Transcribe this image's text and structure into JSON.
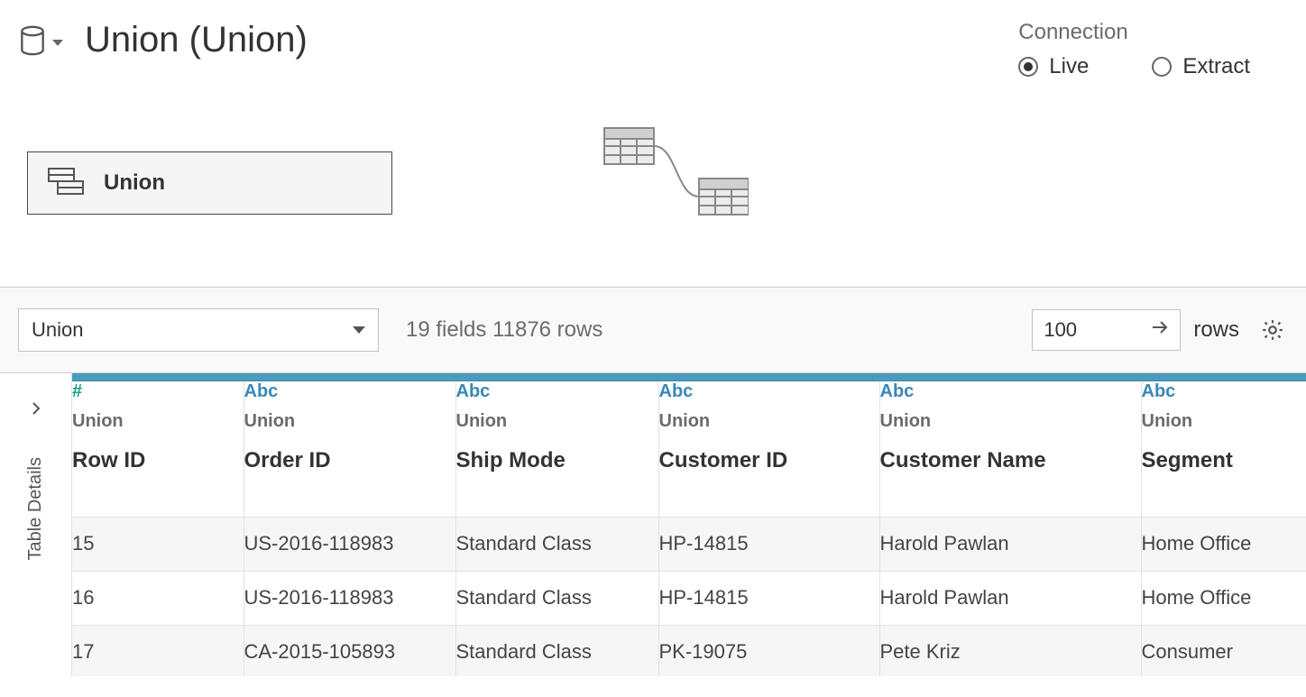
{
  "header": {
    "title": "Union (Union)"
  },
  "connection": {
    "label": "Connection",
    "options": {
      "live": "Live",
      "extract": "Extract"
    },
    "selected": "live"
  },
  "canvas": {
    "union_pill_label": "Union"
  },
  "toolbar": {
    "table_selector_value": "Union",
    "field_summary": "19 fields 11876 rows",
    "rows_input_value": "100",
    "rows_label": "rows"
  },
  "side": {
    "label": "Table Details"
  },
  "columns": [
    {
      "type": "number",
      "type_label": "#",
      "source": "Union",
      "name": "Row ID"
    },
    {
      "type": "text",
      "type_label": "Abc",
      "source": "Union",
      "name": "Order ID"
    },
    {
      "type": "text",
      "type_label": "Abc",
      "source": "Union",
      "name": "Ship Mode"
    },
    {
      "type": "text",
      "type_label": "Abc",
      "source": "Union",
      "name": "Customer ID"
    },
    {
      "type": "text",
      "type_label": "Abc",
      "source": "Union",
      "name": "Customer Name"
    },
    {
      "type": "text",
      "type_label": "Abc",
      "source": "Union",
      "name": "Segment"
    }
  ],
  "rows": [
    {
      "row_id": "15",
      "order_id": "US-2016-118983",
      "ship_mode": "Standard Class",
      "customer_id": "HP-14815",
      "customer_name": "Harold Pawlan",
      "segment": "Home Office"
    },
    {
      "row_id": "16",
      "order_id": "US-2016-118983",
      "ship_mode": "Standard Class",
      "customer_id": "HP-14815",
      "customer_name": "Harold Pawlan",
      "segment": "Home Office"
    },
    {
      "row_id": "17",
      "order_id": "CA-2015-105893",
      "ship_mode": "Standard Class",
      "customer_id": "PK-19075",
      "customer_name": "Pete Kriz",
      "segment": "Consumer"
    }
  ]
}
